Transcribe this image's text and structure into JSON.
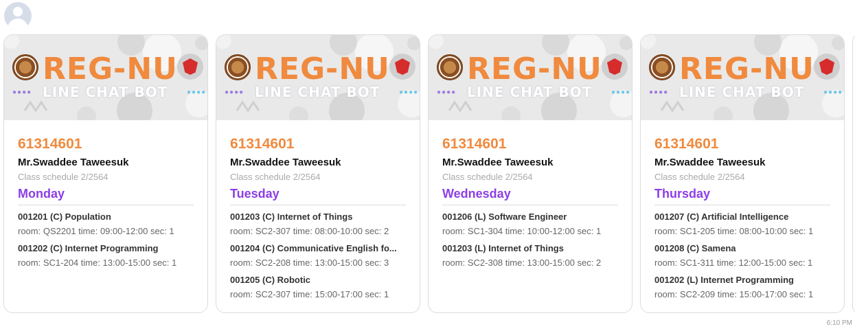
{
  "header": {
    "avatar_icon": "user-avatar-icon"
  },
  "banner": {
    "title": "REG-NU",
    "subtitle": "LINE CHAT BOT",
    "colors": {
      "title": "#f08a3e",
      "background": "#e9e9e9"
    }
  },
  "cards": [
    {
      "student_id": "61314601",
      "name": "Mr.Swaddee Taweesuk",
      "schedule_label": "Class schedule 2/2564",
      "day": "Monday",
      "courses": [
        {
          "title": "001201 (C) Population",
          "info": "room: QS2201 time: 09:00-12:00 sec: 1"
        },
        {
          "title": "001202 (C) Internet Programming",
          "info": "room: SC1-204 time: 13:00-15:00 sec: 1"
        }
      ]
    },
    {
      "student_id": "61314601",
      "name": "Mr.Swaddee Taweesuk",
      "schedule_label": "Class schedule 2/2564",
      "day": "Tuesday",
      "courses": [
        {
          "title": "001203 (C) Internet of Things",
          "info": "room: SC2-307 time: 08:00-10:00 sec: 2"
        },
        {
          "title": "001204 (C) Communicative English fo...",
          "info": "room: SC2-208 time: 13:00-15:00 sec: 3"
        },
        {
          "title": "001205 (C) Robotic",
          "info": "room: SC2-307 time: 15:00-17:00 sec: 1"
        }
      ]
    },
    {
      "student_id": "61314601",
      "name": "Mr.Swaddee Taweesuk",
      "schedule_label": "Class schedule 2/2564",
      "day": "Wednesday",
      "courses": [
        {
          "title": "001206 (L) Software Engineer",
          "info": "room: SC1-304 time: 10:00-12:00 sec: 1"
        },
        {
          "title": "001203 (L) Internet of Things",
          "info": "room: SC2-308 time: 13:00-15:00 sec: 2"
        }
      ]
    },
    {
      "student_id": "61314601",
      "name": "Mr.Swaddee Taweesuk",
      "schedule_label": "Class schedule 2/2564",
      "day": "Thursday",
      "courses": [
        {
          "title": "001207 (C) Artificial Intelligence",
          "info": "room: SC1-205 time: 08:00-10:00 sec: 1"
        },
        {
          "title": "001208 (C) Samena",
          "info": "room: SC1-311 time: 12:00-15:00 sec: 1"
        },
        {
          "title": "001202 (L) Internet Programming",
          "info": "room: SC2-209 time: 15:00-17:00 sec: 1"
        }
      ]
    }
  ],
  "message": {
    "timestamp": "6:10 PM"
  }
}
